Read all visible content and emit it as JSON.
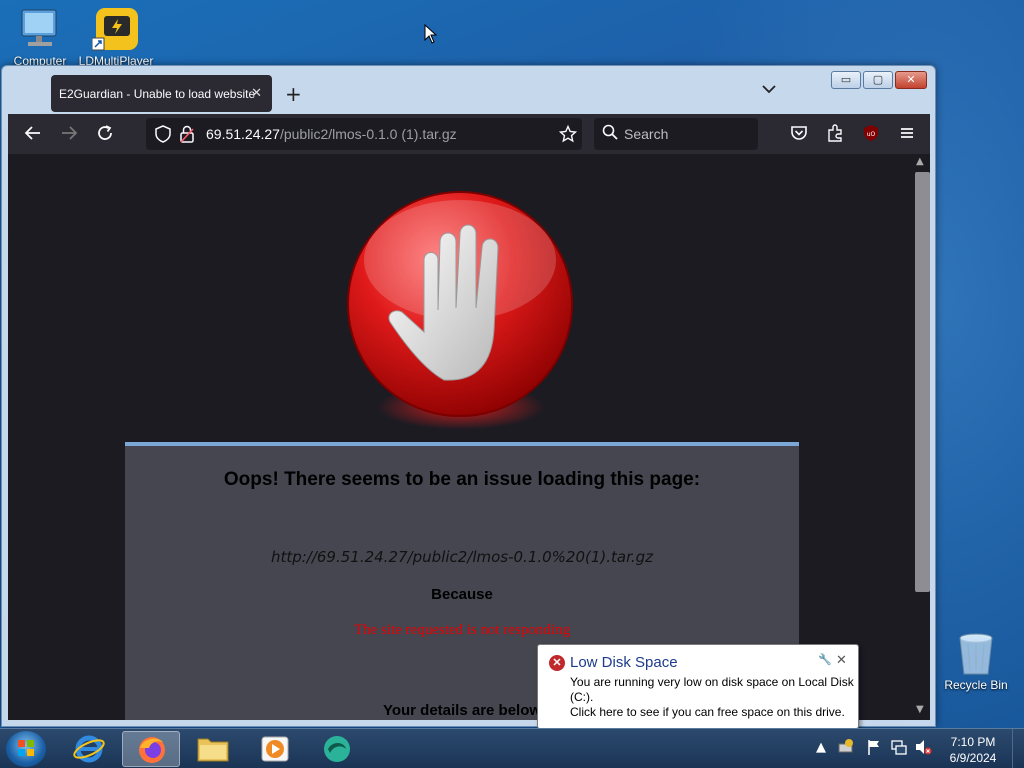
{
  "desktop": {
    "icons": [
      {
        "label": "Computer"
      },
      {
        "label": "LDMultiPlayer"
      },
      {
        "label": "Recycle Bin"
      }
    ]
  },
  "browser": {
    "tab": {
      "title": "E2Guardian - Unable to load website",
      "close": "✕"
    },
    "new_tab": "+",
    "tab_list": "⌄",
    "window_buttons": {
      "minimize": "▭",
      "maximize": "▢",
      "close": "✕"
    },
    "url": {
      "host": "69.51.24.27",
      "path": "/public2/lmos-0.1.0 (1).tar.gz"
    },
    "search_placeholder": "Search",
    "toolbar_icons": [
      "back-icon",
      "forward-icon",
      "reload-icon",
      "shield-icon",
      "lock-icon",
      "bookmark-star-icon",
      "pocket-icon",
      "extensions-icon",
      "ublock-icon",
      "menu-icon"
    ]
  },
  "page": {
    "heading": "Oops! There seems to be an issue loading this page:",
    "blocked_url": "http://69.51.24.27/public2/lmos-0.1.0%20(1).tar.gz",
    "because_label": "Because",
    "reason": "The site requested is not responding",
    "details_label": "Your details are below"
  },
  "notification": {
    "title": "Low Disk Space",
    "message": "You are running very low on disk space on Local Disk (C:).\nClick here to see if you can free space on this drive."
  },
  "taskbar": {
    "pinned": [
      "internet-explorer",
      "firefox",
      "file-explorer",
      "media-player",
      "app"
    ],
    "active": "firefox",
    "clock": {
      "time": "7:10 PM",
      "date": "6/9/2024"
    }
  }
}
